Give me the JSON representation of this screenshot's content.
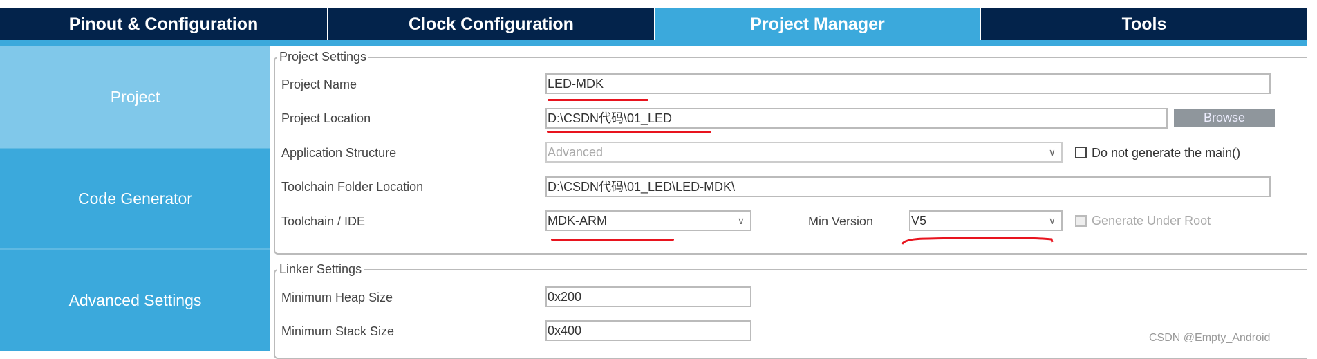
{
  "tabs": [
    {
      "label": "Pinout & Configuration"
    },
    {
      "label": "Clock Configuration"
    },
    {
      "label": "Project Manager",
      "active": true
    },
    {
      "label": "Tools"
    }
  ],
  "sidebar": {
    "items": [
      {
        "label": "Project",
        "active": true
      },
      {
        "label": "Code Generator"
      },
      {
        "label": "Advanced Settings"
      }
    ]
  },
  "project_settings": {
    "legend": "Project Settings",
    "project_name": {
      "label": "Project Name",
      "value": "LED-MDK"
    },
    "project_location": {
      "label": "Project Location",
      "value": "D:\\CSDN代码\\01_LED",
      "browse": "Browse"
    },
    "application_structure": {
      "label": "Application Structure",
      "value": "Advanced",
      "checkbox_label": "Do not generate the main()",
      "checked": false
    },
    "toolchain_folder": {
      "label": "Toolchain Folder Location",
      "value": "D:\\CSDN代码\\01_LED\\LED-MDK\\"
    },
    "toolchain_ide": {
      "label": "Toolchain / IDE",
      "value": "MDK-ARM",
      "min_version_label": "Min Version",
      "min_version": "V5",
      "generate_under_root_label": "Generate Under Root",
      "generate_under_root_checked": false
    }
  },
  "linker_settings": {
    "legend": "Linker Settings",
    "heap": {
      "label": "Minimum Heap Size",
      "value": "0x200"
    },
    "stack": {
      "label": "Minimum Stack Size",
      "value": "0x400"
    }
  },
  "watermark": "CSDN @Empty_Android",
  "colors": {
    "tab_dark": "#03234b",
    "accent": "#3ba9dc",
    "sidebar_active": "#80c8ea",
    "annotation_red": "#e8141e"
  }
}
